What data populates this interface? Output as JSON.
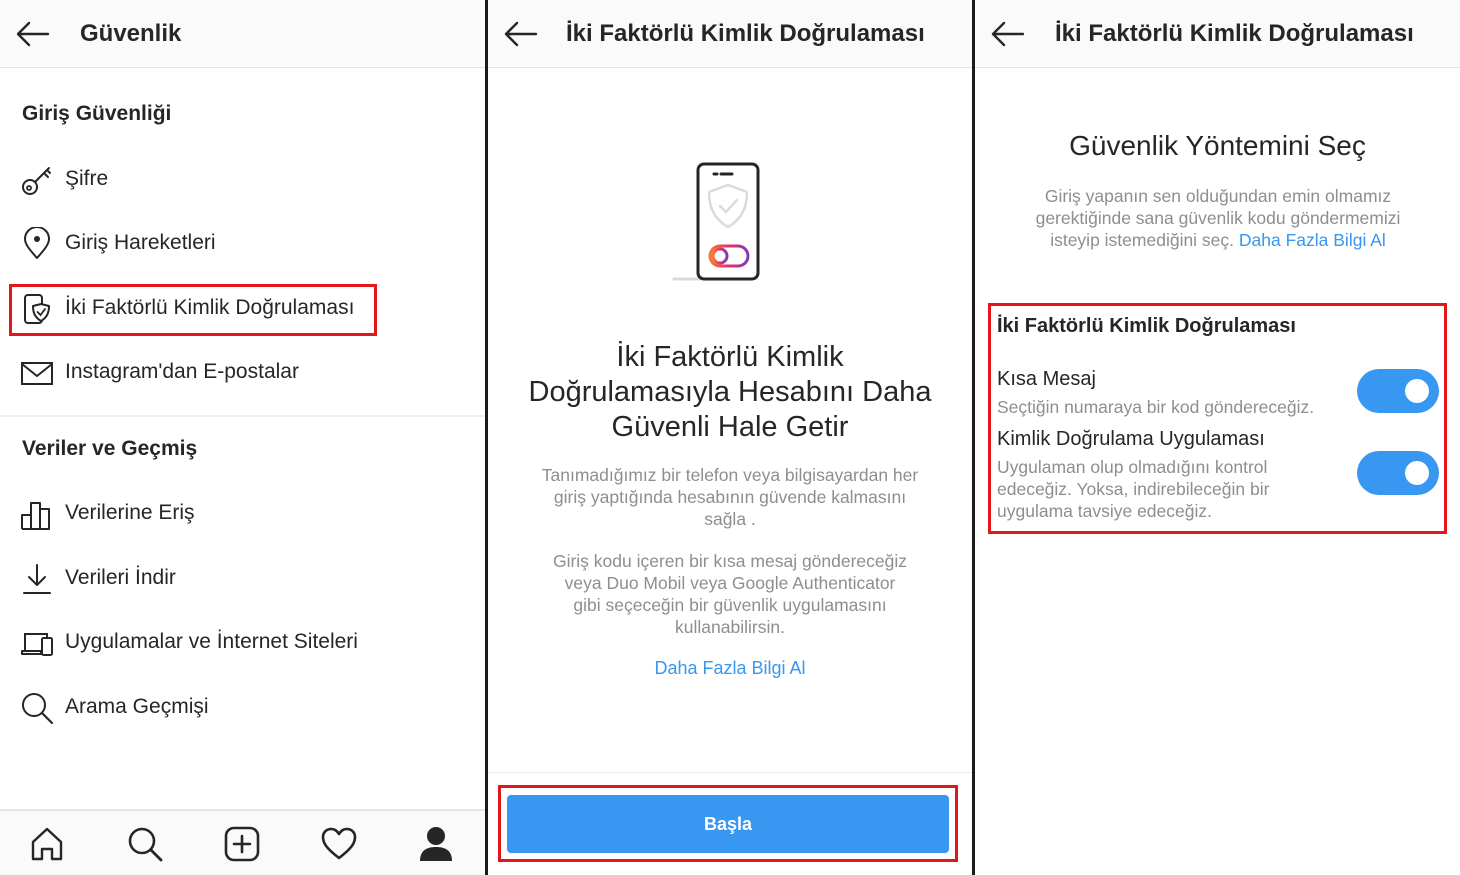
{
  "colors": {
    "accent": "#3897f0",
    "highlight": "#e3161b",
    "muted": "#8e8e8e",
    "text": "#262626"
  },
  "panel1": {
    "header": {
      "title": "Güvenlik"
    },
    "login_security": {
      "title": "Giriş Güvenliği",
      "items": [
        {
          "label": "Şifre",
          "icon": "key-icon"
        },
        {
          "label": "Giriş Hareketleri",
          "icon": "location-pin-icon"
        },
        {
          "label": "İki Faktörlü Kimlik Doğrulaması",
          "icon": "phone-shield-icon"
        },
        {
          "label": "Instagram'dan E-postalar",
          "icon": "mail-icon"
        }
      ]
    },
    "data_history": {
      "title": "Veriler ve Geçmiş",
      "items": [
        {
          "label": "Verilerine Eriş",
          "icon": "bar-chart-icon"
        },
        {
          "label": "Verileri İndir",
          "icon": "download-icon"
        },
        {
          "label": "Uygulamalar ve İnternet Siteleri",
          "icon": "devices-icon"
        },
        {
          "label": "Arama Geçmişi",
          "icon": "search-icon"
        }
      ]
    },
    "bottom_nav": [
      "home-icon",
      "search-icon",
      "add-post-icon",
      "heart-icon",
      "profile-icon"
    ]
  },
  "panel2": {
    "header": {
      "title": "İki Faktörlü Kimlik Doğrulaması"
    },
    "heading_lines": [
      "İki Faktörlü Kimlik",
      "Doğrulamasıyla Hesabını Daha",
      "Güvenli Hale Getir"
    ],
    "desc1_lines": [
      "Tanımadığımız bir telefon veya bilgisayardan her",
      "giriş yaptığında hesabının güvende kalmasını",
      "sağla ."
    ],
    "desc2_lines": [
      "Giriş kodu içeren bir kısa mesaj göndereceğiz",
      "veya Duo Mobil veya Google Authenticator",
      "gibi seçeceğin bir güvenlik uygulamasını",
      "kullanabilirsin."
    ],
    "learn_more": "Daha Fazla Bilgi Al",
    "start_button": "Başla"
  },
  "panel3": {
    "header": {
      "title": "İki Faktörlü Kimlik Doğrulaması"
    },
    "heading": "Güvenlik Yöntemini Seç",
    "desc_lines": [
      "Giriş yapanın sen olduğundan emin olmamız",
      "gerektiğinde sana güvenlik kodu göndermemizi"
    ],
    "desc_last": "isteyip istemediğini seç.",
    "learn_more": "Daha Fazla Bilgi Al",
    "section_title": "İki Faktörlü Kimlik Doğrulaması",
    "options": [
      {
        "title": "Kısa Mesaj",
        "desc_lines": [
          "Seçtiğin numaraya bir kod göndereceğiz."
        ],
        "enabled": true
      },
      {
        "title": "Kimlik Doğrulama Uygulaması",
        "desc_lines": [
          "Uygulaman olup olmadığını kontrol",
          "edeceğiz. Yoksa, indirebileceğin bir",
          "uygulama tavsiye edeceğiz."
        ],
        "enabled": true
      }
    ]
  }
}
